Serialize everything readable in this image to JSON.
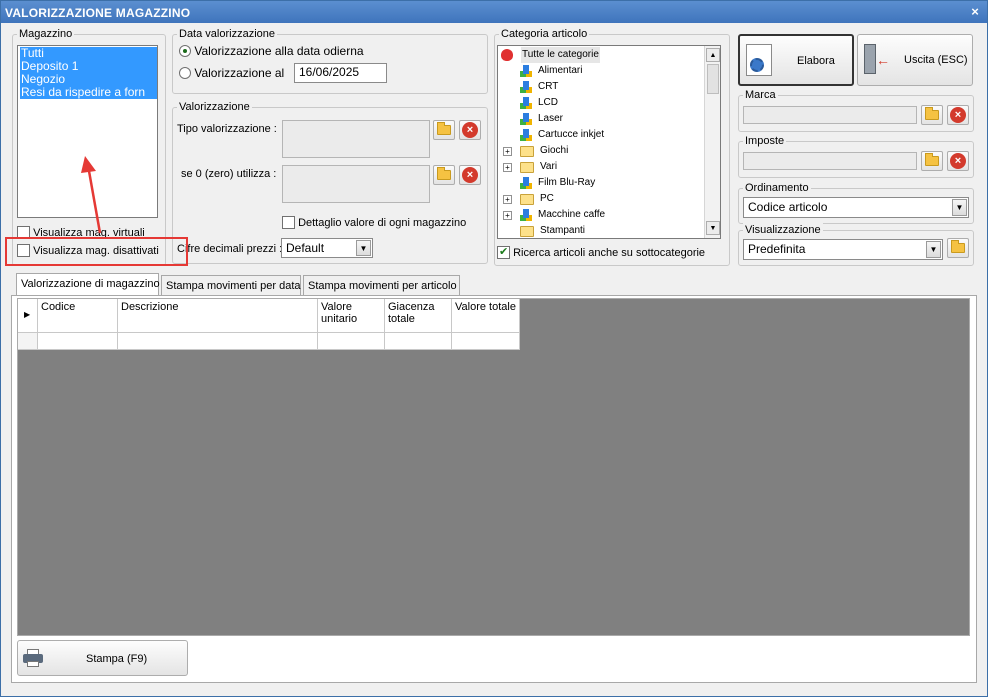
{
  "window": {
    "title": "VALORIZZAZIONE MAGAZZINO",
    "close_glyph": "×"
  },
  "magazzino": {
    "label": "Magazzino",
    "items": [
      "Tutti",
      "Deposito 1",
      "Negozio",
      "Resi da rispedire a forn"
    ],
    "chk_virtuali": "Visualizza mag. virtuali",
    "chk_disattivati": "Visualizza mag. disattivati"
  },
  "data_valorizzazione": {
    "label": "Data valorizzazione",
    "option_odierna": "Valorizzazione alla data odierna",
    "option_al": "Valorizzazione al",
    "date_value": "16/06/2025"
  },
  "valorizzazione": {
    "label": "Valorizzazione",
    "tipo_label": "Tipo valorizzazione :",
    "zero_label": "se 0 (zero) utilizza :",
    "dettaglio_label": "Dettaglio valore di ogni magazzino",
    "cifre_label": "Cifre decimali prezzi :",
    "cifre_value": "Default"
  },
  "categoria": {
    "label": "Categoria articolo",
    "root": "Tutte le categorie",
    "nodes": [
      "Alimentari",
      "CRT",
      "LCD",
      "Laser",
      "Cartucce inkjet",
      "Giochi",
      "Vari",
      "Film Blu-Ray",
      "PC",
      "Macchine caffe",
      "Stampanti"
    ],
    "ricerca_label": "Ricerca articoli anche su sottocategorie"
  },
  "buttons": {
    "elabora": "Elabora",
    "uscita": "Uscita (ESC)",
    "stampa": "Stampa (F9)"
  },
  "marca": {
    "label": "Marca"
  },
  "imposte": {
    "label": "Imposte"
  },
  "ordinamento": {
    "label": "Ordinamento",
    "value": "Codice articolo"
  },
  "visualizzazione": {
    "label": "Visualizzazione",
    "value": "Predefinita"
  },
  "tabs": [
    "Valorizzazione di magazzino",
    "Stampa movimenti per data",
    "Stampa movimenti per articolo"
  ],
  "grid": {
    "columns": [
      "Codice",
      "Descrizione",
      "Valore unitario",
      "Giacenza totale",
      "Valore totale"
    ]
  },
  "colors": {
    "titlebar": "#4a80c6",
    "selection": "#3399ff",
    "highlight": "#e53935",
    "grid_bg": "#808080"
  }
}
